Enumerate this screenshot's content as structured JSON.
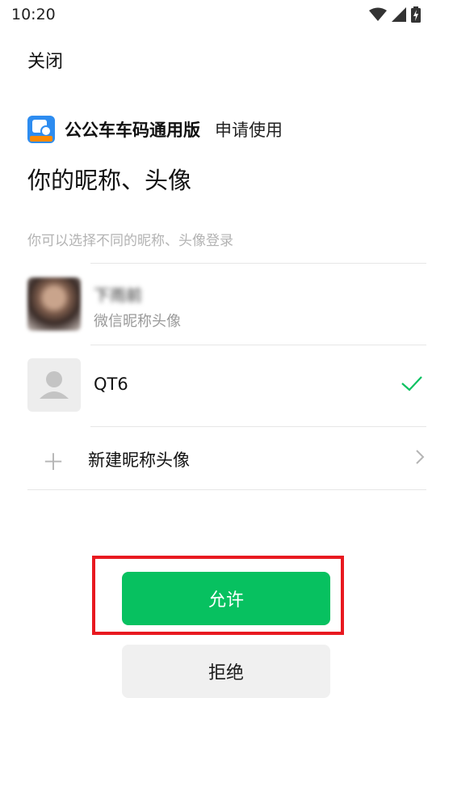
{
  "status_bar": {
    "time": "10:20"
  },
  "header": {
    "close_label": "关闭"
  },
  "app": {
    "name": "公公车车码通用版",
    "request_label": "申请使用",
    "logo_text": "实时公交"
  },
  "title": "你的昵称、头像",
  "hint": "你可以选择不同的昵称、头像登录",
  "options": {
    "wechat": {
      "name": "下雨前",
      "sub_label": "微信昵称头像"
    },
    "custom": {
      "name": "QT6",
      "selected": true
    },
    "new_label": "新建昵称头像"
  },
  "buttons": {
    "allow": "允许",
    "deny": "拒绝"
  },
  "colors": {
    "primary": "#07c160",
    "highlight": "#e81920",
    "check": "#07c160"
  }
}
